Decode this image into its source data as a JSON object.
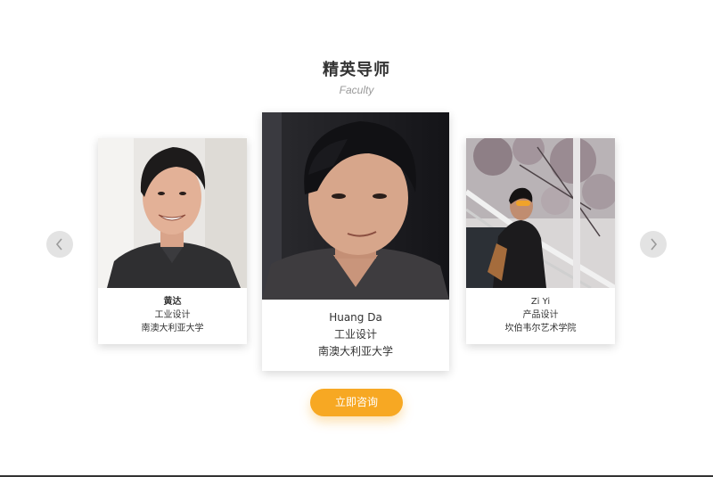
{
  "section": {
    "title": "精英导师",
    "subtitle": "Faculty"
  },
  "cards": [
    {
      "name": "黄达",
      "major": "工业设计",
      "school": "南澳大利亚大学",
      "photo": "portrait-smiling-man-icon"
    },
    {
      "name": "Huang Da",
      "major": "工业设计",
      "school": "南澳大利亚大学",
      "photo": "portrait-man-closeup-icon"
    },
    {
      "name": "Zi Yi",
      "major": "产品设计",
      "school": "坎伯韦尔艺术学院",
      "photo": "portrait-man-cherry-blossom-icon"
    }
  ],
  "nav": {
    "prev_icon": "chevron-left-icon",
    "next_icon": "chevron-right-icon"
  },
  "cta": {
    "label": "立即咨询",
    "color": "#f7a823"
  }
}
